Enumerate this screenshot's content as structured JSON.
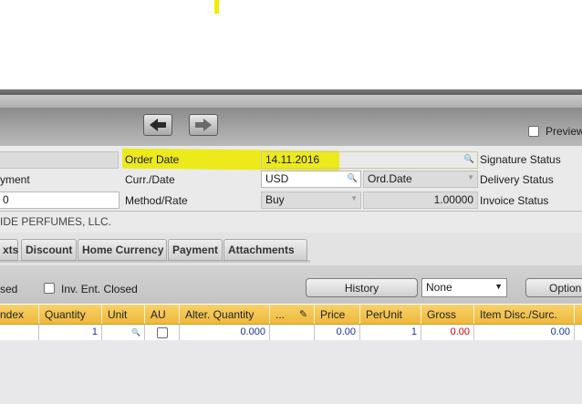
{
  "header": {
    "preview_label": "Preview"
  },
  "form": {
    "row1": {
      "left_value": "",
      "order_date_label": "Order Date",
      "order_date_value": "14.11.2016",
      "signature_status_label": "Signature Status"
    },
    "row2": {
      "left_label": "yment",
      "curr_date_label": "Curr./Date",
      "currency_value": "USD",
      "ord_date_value": "Ord.Date",
      "delivery_status_label": "Delivery Status"
    },
    "row3": {
      "left_value": "0",
      "method_rate_label": "Method/Rate",
      "method_value": "Buy",
      "rate_value": "1.00000",
      "invoice_status_label": "Invoice Status"
    },
    "company_name": "IDE PERFUMES, LLC."
  },
  "tabs": [
    {
      "label": "xts"
    },
    {
      "label": "Discount"
    },
    {
      "label": "Home Currency"
    },
    {
      "label": "Payment"
    },
    {
      "label": "Attachments"
    }
  ],
  "toolbar": {
    "closed_label": "sed",
    "inv_ent_closed_label": "Inv. Ent. Closed",
    "history_button": "History",
    "none_select": "None",
    "options_button": "Option"
  },
  "grid": {
    "columns": [
      "ndex",
      "Quantity",
      "Unit",
      "AU",
      "Alter. Quantity",
      "...",
      "Price",
      "PerUnit",
      "Gross",
      "Item Disc./Surc."
    ],
    "row": {
      "index": "",
      "quantity": "1",
      "unit": "",
      "alter_quantity": "0.000",
      "price": "0.00",
      "per_unit": "1",
      "gross": "0.00",
      "item_disc": "0.00"
    }
  },
  "colors": {
    "highlight": "#ecea1a",
    "grid_header": "#f2c04a",
    "gross_value": "#cc0000",
    "value_blue": "#1e32a0"
  }
}
